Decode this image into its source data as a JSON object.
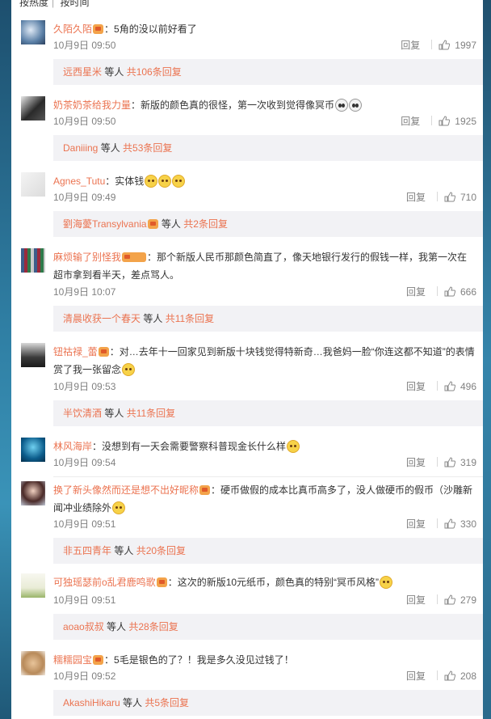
{
  "sort_tabs": {
    "hot": "按热度",
    "time": "按时间"
  },
  "reply_label": "回复",
  "and_others": "等人",
  "comments": [
    {
      "user": "久陌久陌",
      "badge": true,
      "text": "5角的没以前好看了",
      "emojis": [],
      "time": "10月9日 09:50",
      "likes": "1997",
      "reply_user": "远西星米",
      "reply_count": "共106条回复"
    },
    {
      "user": "奶茶奶茶给我力量",
      "badge": false,
      "text": "新版的颜色真的很怪，第一次收到觉得像冥币",
      "emojis": [
        "skull",
        "skull"
      ],
      "time": "10月9日 09:50",
      "likes": "1925",
      "reply_user": "Daniiing",
      "reply_count": "共53条回复"
    },
    {
      "user": "Agnes_Tutu",
      "badge": false,
      "text": "实体钱",
      "emojis": [
        "doge",
        "doge",
        "doge"
      ],
      "time": "10月9日 09:49",
      "likes": "710",
      "reply_user": "劉海薆Transylvania",
      "reply_count": "共2条回复"
    },
    {
      "user": "麻烦输了别怪我",
      "badge": true,
      "text": "那个新版人民币那颜色简直了，像天地银行发行的假钱一样，我第一次在超市拿到看半天，差点骂人。",
      "emojis": [],
      "time": "10月9日 10:07",
      "likes": "666",
      "reply_user": "清晨收获一个春天",
      "reply_count": "共11条回复"
    },
    {
      "user": "钮祜禄_蕾",
      "badge": true,
      "text": "对…去年十一回家见到新版十块钱觉得特新奇…我爸妈一脸“你连这都不知道”的表情赏了我一张留念",
      "emojis": [
        "laugh"
      ],
      "time": "10月9日 09:53",
      "likes": "496",
      "reply_user": "半饮清酒",
      "reply_count": "共11条回复"
    },
    {
      "user": "林风海岸",
      "badge": false,
      "text": "没想到有一天会需要警察科普现金长什么样",
      "emojis": [
        "laugh"
      ],
      "time": "10月9日 09:54",
      "likes": "319",
      "reply_user": "",
      "reply_count": ""
    },
    {
      "user": "换了新头像然而还是想不出好昵称",
      "badge": true,
      "text": "硬币做假的成本比真币高多了，没人做硬币的假币（沙雕新闻冲业绩除外",
      "emojis": [
        "doge"
      ],
      "time": "10月9日 09:51",
      "likes": "330",
      "reply_user": "非五四青年",
      "reply_count": "共20条回复"
    },
    {
      "user": "可独瑶瑟前o乱君鹿鸣歌",
      "badge": true,
      "text": "这次的新版10元纸币，颜色真的特别“冥币风格”",
      "emojis": [
        "laugh"
      ],
      "time": "10月9日 09:51",
      "likes": "279",
      "reply_user": "aoao叔叔",
      "reply_count": "共28条回复"
    },
    {
      "user": "糯糯园宝",
      "badge": true,
      "text": "5毛是银色的了？！我是多久没见过钱了！",
      "emojis": [],
      "time": "10月9日 09:52",
      "likes": "208",
      "reply_user": "AkashiHikaru",
      "reply_count": "共5条回复"
    }
  ]
}
